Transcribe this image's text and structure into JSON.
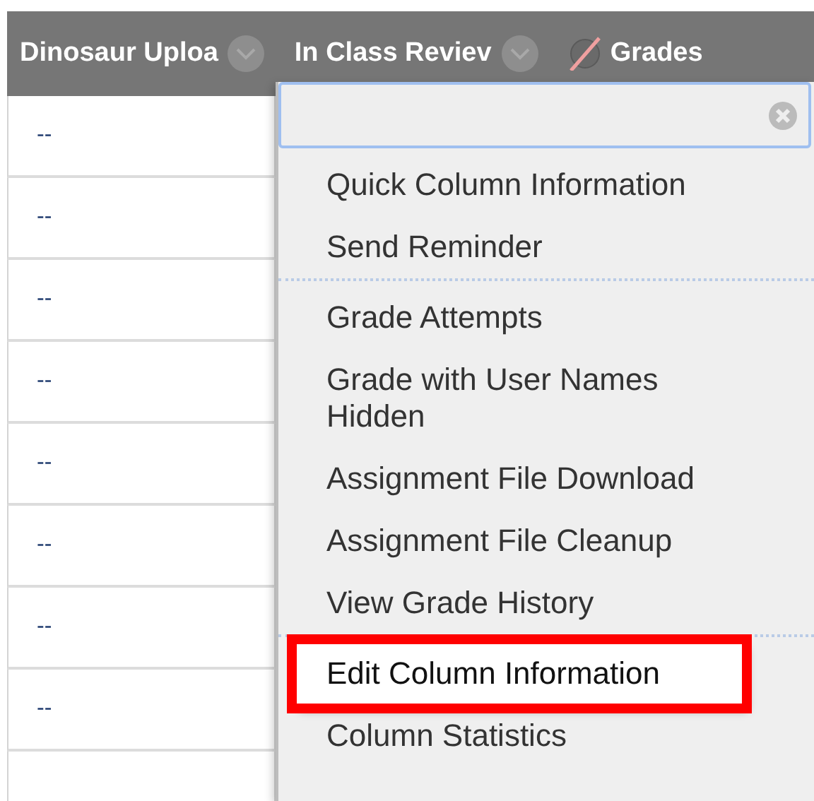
{
  "table": {
    "columns": [
      {
        "label": "Dinosaur Uploa",
        "kind": "menu"
      },
      {
        "label": "In Class Reviev",
        "kind": "menu"
      },
      {
        "label": "Grades",
        "kind": "hidden"
      }
    ],
    "cells": [
      "--",
      "--",
      "--",
      "--",
      "--",
      "--",
      "--",
      "--"
    ]
  },
  "menu": {
    "groups": [
      [
        {
          "label": "Quick Column Information",
          "highlighted": false
        },
        {
          "label": "Send Reminder",
          "highlighted": false
        }
      ],
      [
        {
          "label": "Grade Attempts",
          "highlighted": false
        },
        {
          "label": "Grade with User Names Hidden",
          "highlighted": false
        },
        {
          "label": "Assignment File Download",
          "highlighted": false
        },
        {
          "label": "Assignment File Cleanup",
          "highlighted": false
        },
        {
          "label": "View Grade History",
          "highlighted": false
        }
      ],
      [
        {
          "label": "Edit Column Information",
          "highlighted": true
        },
        {
          "label": "Column Statistics",
          "highlighted": false
        }
      ]
    ]
  }
}
